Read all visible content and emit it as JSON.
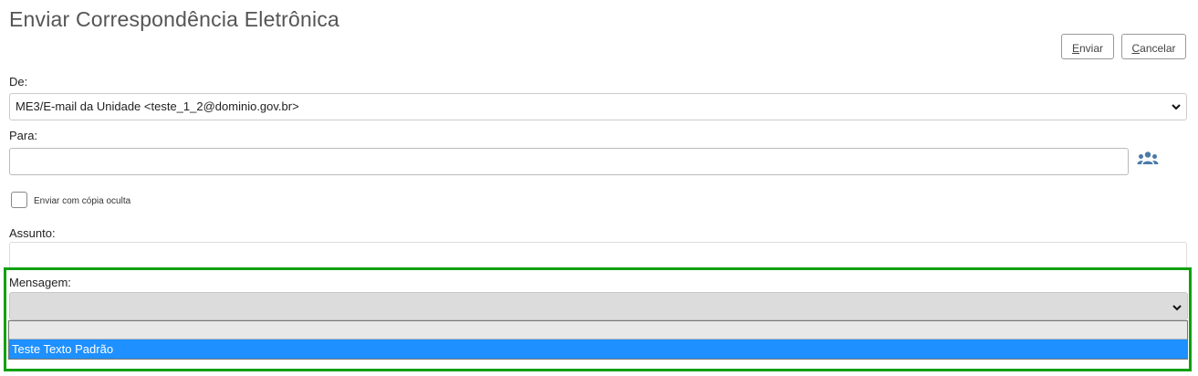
{
  "page": {
    "title": "Enviar Correspondência Eletrônica"
  },
  "toolbar": {
    "send_accesskey": "E",
    "send_rest": "nviar",
    "cancel_accesskey": "C",
    "cancel_rest": "ancelar"
  },
  "form": {
    "from_label": "De:",
    "from_value": "ME3/E-mail da Unidade <teste_1_2@dominio.gov.br>",
    "to_label": "Para:",
    "to_value": "",
    "bcc_label": "Enviar com cópia oculta",
    "bcc_checked": false,
    "subject_label": "Assunto:",
    "subject_value": "",
    "message_label": "Mensagem:",
    "message_selected": "",
    "message_options": [
      "",
      "Teste Texto Padrão"
    ]
  },
  "icons": {
    "recipients": "group-icon",
    "dropdown": "chevron-down-icon"
  },
  "colors": {
    "highlight_border": "#11a011",
    "selected_option_bg": "#1e90ff"
  }
}
